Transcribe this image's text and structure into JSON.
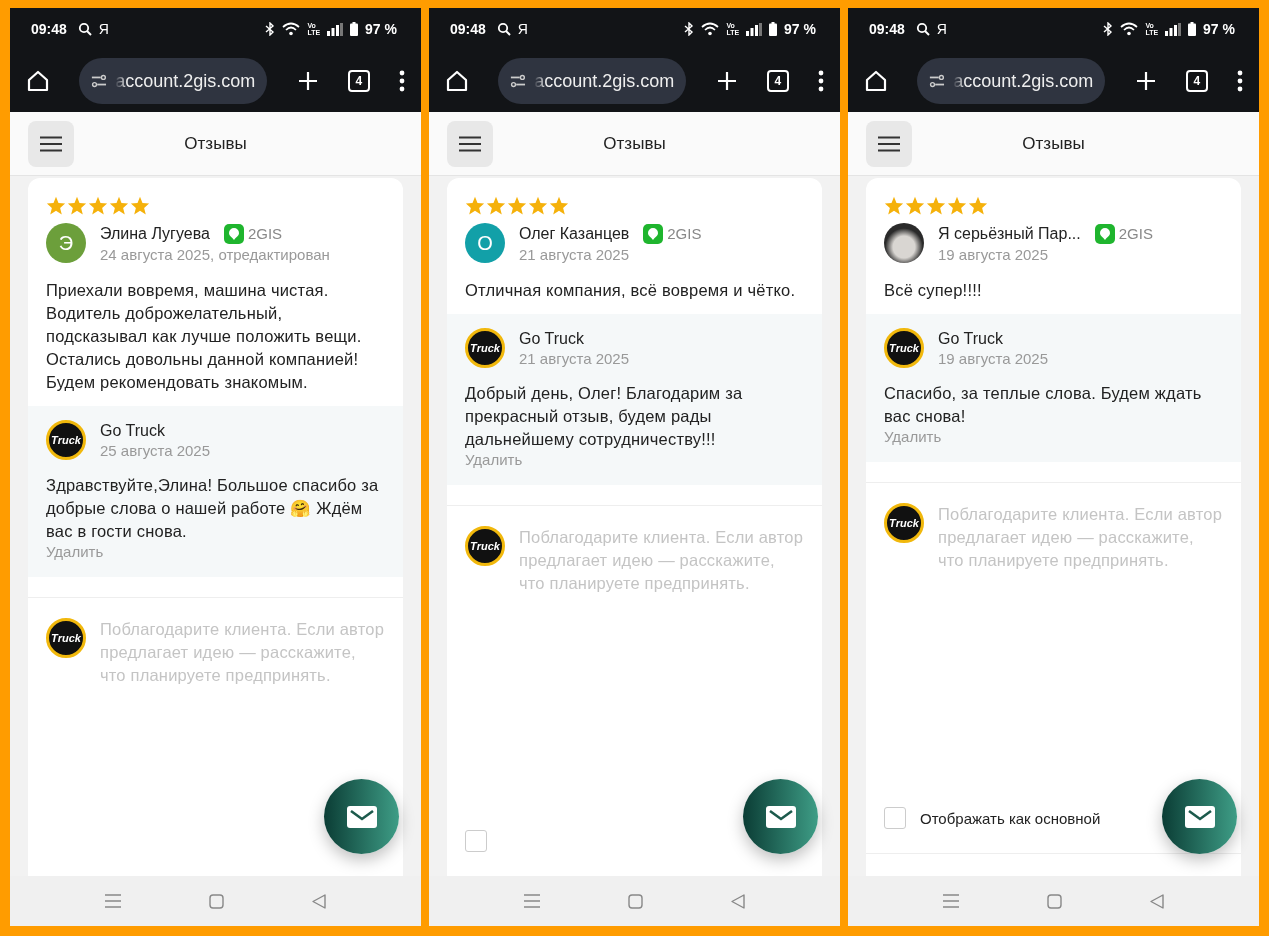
{
  "phones": [
    {
      "status_bar": {
        "time": "09:48",
        "app_glyph": "Я",
        "network_top": "Vo",
        "network_bottom": "LTE",
        "battery": "97 %"
      },
      "browser": {
        "url": "account.2gis.com",
        "tab_count": "4"
      },
      "header": {
        "title": "Отзывы"
      },
      "review": {
        "stars": 5,
        "avatar": {
          "kind": "letter",
          "letter": "Э",
          "color": "#6c9f3b"
        },
        "author": "Элина Лугуева",
        "source": "2GIS",
        "date": "24 августа 2025, отредактирован",
        "text": "Приехали вовремя, машина чистая. Водитель доброжелательный, подсказывал как лучше положить вещи. Остались довольны данной компанией! Будем рекомендовать знакомым."
      },
      "reply": {
        "logo_text": "Truck",
        "author": "Go Truck",
        "date": "25 августа 2025",
        "text": "Здравствуйте,Элина! Большое спасибо за добрые слова о нашей работе 🤗 Ждём вас в гости снова.",
        "delete": "Удалить"
      },
      "compose": {
        "logo_text": "Truck",
        "placeholder": "Поблагодарите клиента. Если автор предлагает идею — расскажите, что планируете предпринять."
      }
    },
    {
      "status_bar": {
        "time": "09:48",
        "app_glyph": "Я",
        "network_top": "Vo",
        "network_bottom": "LTE",
        "battery": "97 %"
      },
      "browser": {
        "url": "account.2gis.com",
        "tab_count": "4"
      },
      "header": {
        "title": "Отзывы"
      },
      "review": {
        "stars": 5,
        "avatar": {
          "kind": "letter",
          "letter": "О",
          "color": "#12a0a8"
        },
        "author": "Олег Казанцев",
        "source": "2GIS",
        "date": "21 августа 2025",
        "text": "Отличная компания, всё вовремя и чётко."
      },
      "reply": {
        "logo_text": "Truck",
        "author": "Go Truck",
        "date": "21 августа 2025",
        "text": "Добрый день, Олег! Благодарим за прекрасный отзыв, будем рады дальнейшему сотрудничеству!!!",
        "delete": "Удалить"
      },
      "compose": {
        "logo_text": "Truck",
        "placeholder": "Поблагодарите клиента. Если автор предлагает идею — расскажите, что планируете предпринять."
      },
      "primary_checkbox": {
        "checked": false
      }
    },
    {
      "status_bar": {
        "time": "09:48",
        "app_glyph": "Я",
        "network_top": "Vo",
        "network_bottom": "LTE",
        "battery": "97 %"
      },
      "browser": {
        "url": "account.2gis.com",
        "tab_count": "4"
      },
      "header": {
        "title": "Отзывы"
      },
      "review": {
        "stars": 5,
        "avatar": {
          "kind": "photo"
        },
        "author": "Я серьёзный Пар...",
        "source": "2GIS",
        "date": "19 августа 2025",
        "text": "Всё супер!!!!"
      },
      "reply": {
        "logo_text": "Truck",
        "author": "Go Truck",
        "date": "19 августа 2025",
        "text": "Спасибо, за теплые слова. Будем ждать вас снова!",
        "delete": "Удалить"
      },
      "compose": {
        "logo_text": "Truck",
        "placeholder": "Поблагодарите клиента. Если автор предлагает идею — расскажите, что планируете предпринять."
      },
      "primary_checkbox": {
        "label": "Отображать как основной",
        "checked": false
      }
    }
  ]
}
